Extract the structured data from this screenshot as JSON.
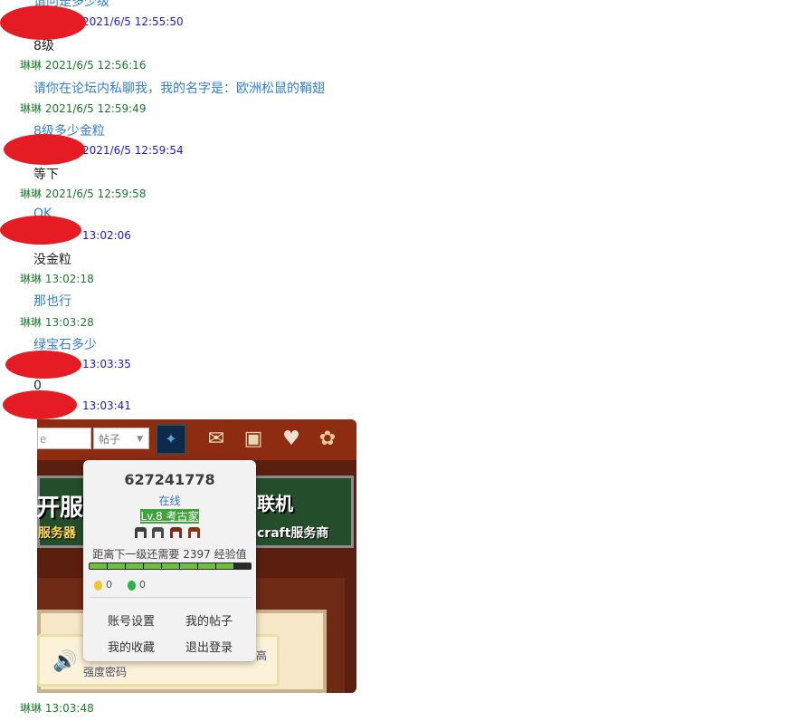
{
  "colors": {
    "my_header": "#1a7a2a",
    "other_header": "#1a1ad6",
    "my_text": "#2f7fd6",
    "other_text": "#222222",
    "redaction": "#e51c23"
  },
  "chat": {
    "entries": [
      {
        "kind": "msg",
        "side": "me",
        "text": "请问是多少级"
      },
      {
        "kind": "hdr",
        "side": "other",
        "name": "",
        "time": "2021/6/5 12:55:50"
      },
      {
        "kind": "msg",
        "side": "other",
        "text": "8级"
      },
      {
        "kind": "hdr",
        "side": "me",
        "name": "琳琳",
        "time": "2021/6/5 12:56:16"
      },
      {
        "kind": "msg",
        "side": "me",
        "text": "请你在论坛内私聊我，我的名字是：欧洲松鼠的鞘翅"
      },
      {
        "kind": "hdr",
        "side": "me",
        "name": "琳琳",
        "time": "2021/6/5 12:59:49"
      },
      {
        "kind": "msg",
        "side": "me",
        "text": "8级多少金粒"
      },
      {
        "kind": "hdr",
        "side": "other",
        "name": "",
        "time": "2021/6/5 12:59:54"
      },
      {
        "kind": "msg",
        "side": "other",
        "text": "等下"
      },
      {
        "kind": "hdr",
        "side": "me",
        "name": "琳琳",
        "time": "2021/6/5 12:59:58"
      },
      {
        "kind": "msg",
        "side": "me",
        "text": "OK"
      },
      {
        "kind": "hdr",
        "side": "other",
        "name": "",
        "time": "13:02:06"
      },
      {
        "kind": "msg",
        "side": "other",
        "text": "没金粒"
      },
      {
        "kind": "hdr",
        "side": "me",
        "name": "琳琳",
        "time": "13:02:18"
      },
      {
        "kind": "msg",
        "side": "me",
        "text": "那也行"
      },
      {
        "kind": "hdr",
        "side": "me",
        "name": "琳琳",
        "time": "13:03:28"
      },
      {
        "kind": "msg",
        "side": "me",
        "text": "绿宝石多少"
      },
      {
        "kind": "hdr",
        "side": "other",
        "name": "",
        "time": "13:03:35"
      },
      {
        "kind": "msg",
        "side": "other",
        "text": "0"
      },
      {
        "kind": "hdr",
        "side": "other",
        "name": "",
        "time": "13:03:41"
      },
      {
        "kind": "hdr",
        "side": "me",
        "name": "琳琳",
        "time": "13:03:48"
      }
    ]
  },
  "screenshot": {
    "search_text": "e",
    "select_label": "帖子",
    "banner_left": "开服",
    "banner_left_sub": "服务器",
    "banner_right": "联机",
    "banner_right_sub": "craft服务商",
    "notice_line1": "高",
    "notice_line2": "强度密码",
    "icons": [
      "avatar-icon",
      "envelope-icon",
      "box-icon",
      "gift-icon",
      "palette-icon",
      "speaker-icon"
    ]
  },
  "popup": {
    "user_id": "627241778",
    "status": "在线",
    "level": "Lv.8 考古家",
    "xp_prefix": "距离下一级还需要",
    "xp_value": "2397",
    "xp_suffix": "经验值",
    "xp_progress": 0.9,
    "gold_count": "0",
    "emerald_count": "0",
    "menu": [
      "账号设置",
      "我的帖子",
      "我的收藏",
      "退出登录"
    ]
  }
}
